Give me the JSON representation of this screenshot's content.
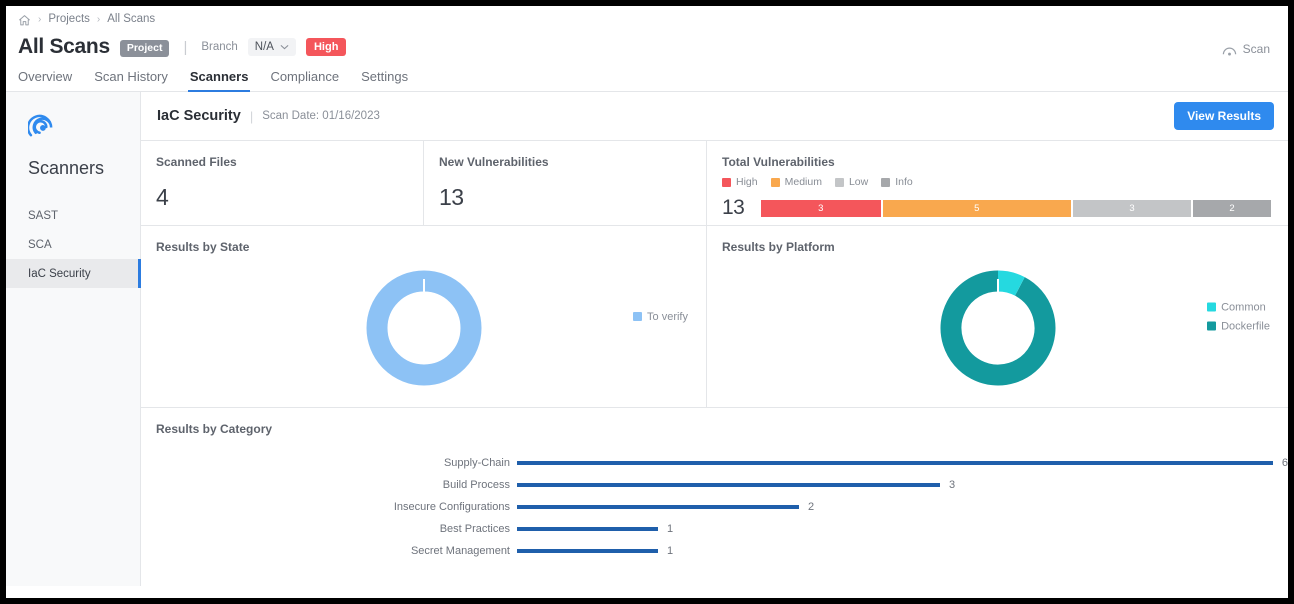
{
  "breadcrumb": {
    "home_icon": "home-icon",
    "items": [
      "Projects",
      "All Scans"
    ],
    "separator": "›"
  },
  "header": {
    "title": "All Scans",
    "project_badge": "Project",
    "divider": "|",
    "branch_label": "Branch",
    "branch_value": "N/A",
    "branch_caret": "⌄",
    "severity_badge": "High",
    "scan_action": "Scan"
  },
  "tabs": [
    {
      "label": "Overview",
      "active": false
    },
    {
      "label": "Scan History",
      "active": false
    },
    {
      "label": "Scanners",
      "active": true
    },
    {
      "label": "Compliance",
      "active": false
    },
    {
      "label": "Settings",
      "active": false
    }
  ],
  "sidebar": {
    "logo_icon": "scanner-spiral-icon",
    "title": "Scanners",
    "items": [
      {
        "label": "SAST",
        "selected": false
      },
      {
        "label": "SCA",
        "selected": false
      },
      {
        "label": "IaC Security",
        "selected": true
      }
    ]
  },
  "panel": {
    "title": "IaC Security",
    "divider": "|",
    "scan_date_label": "Scan Date: 01/16/2023",
    "view_results_button": "View Results"
  },
  "stats": {
    "scanned_files": {
      "label": "Scanned Files",
      "value": "4"
    },
    "new_vulnerabilities": {
      "label": "New Vulnerabilities",
      "value": "13"
    },
    "total_vulnerabilities": {
      "label": "Total Vulnerabilities",
      "total": "13",
      "legend": [
        {
          "label": "High",
          "color": "#f4565b"
        },
        {
          "label": "Medium",
          "color": "#f9a84e"
        },
        {
          "label": "Low",
          "color": "#c3c5c7"
        },
        {
          "label": "Info",
          "color": "#a6a8ab"
        }
      ],
      "segments": [
        {
          "label": "High",
          "value": "3",
          "color": "#f4565b",
          "width_pct": 23.5
        },
        {
          "label": "Medium",
          "value": "5",
          "color": "#f9a84e",
          "width_pct": 37.0
        },
        {
          "label": "Low",
          "value": "3",
          "color": "#c3c5c7",
          "width_pct": 23.2
        },
        {
          "label": "Info",
          "value": "2",
          "color": "#a6a8ab",
          "width_pct": 15.3
        }
      ]
    }
  },
  "chart_data": [
    {
      "type": "pie",
      "name": "results-by-state",
      "title": "Results by State",
      "legend_position": "right",
      "labels": [
        "To verify"
      ],
      "values": [
        13
      ],
      "colors": [
        "#8dc2f5"
      ],
      "donut": true
    },
    {
      "type": "pie",
      "name": "results-by-platform",
      "title": "Results by Platform",
      "legend_position": "right",
      "labels": [
        "Common",
        "Dockerfile"
      ],
      "values": [
        1,
        12
      ],
      "colors": [
        "#25d9e0",
        "#139a9e"
      ],
      "donut": true
    },
    {
      "type": "bar",
      "name": "results-by-category",
      "title": "Results by Category",
      "orientation": "horizontal",
      "xlabel": "",
      "ylabel": "",
      "categories": [
        "Supply-Chain",
        "Build Process",
        "Insecure Configurations",
        "Best Practices",
        "Secret Management"
      ],
      "values": [
        6,
        3,
        2,
        1,
        1
      ],
      "bar_color": "#1f5fab",
      "xlim": [
        0,
        6.5
      ],
      "grid": false
    }
  ]
}
